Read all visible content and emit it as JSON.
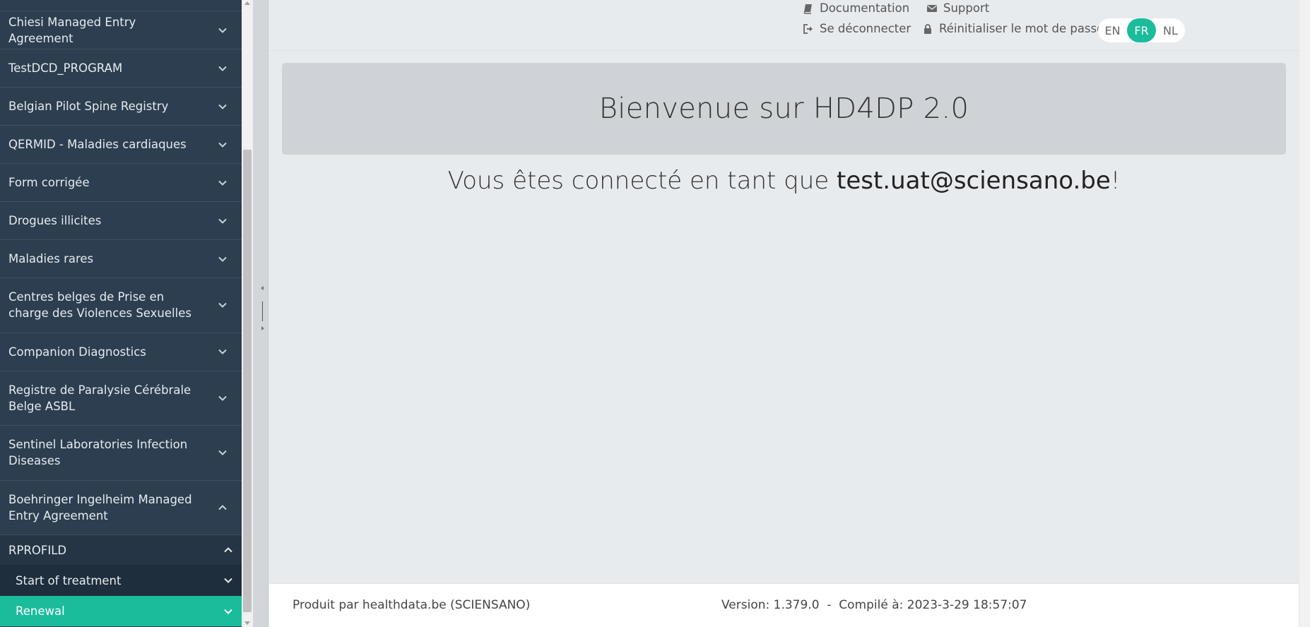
{
  "sidebar": {
    "items": [
      {
        "label": "Chiesi Managed Entry Agreement"
      },
      {
        "label": "TestDCD_PROGRAM"
      },
      {
        "label": "Belgian Pilot Spine Registry"
      },
      {
        "label": "QERMID - Maladies cardiaques"
      },
      {
        "label": "Form corrigée"
      },
      {
        "label": "Drogues illicites"
      },
      {
        "label": "Maladies rares"
      },
      {
        "label": "Centres belges de Prise en charge des Violences Sexuelles"
      },
      {
        "label": "Companion Diagnostics"
      },
      {
        "label": "Registre de Paralysie Cérébrale Belge ASBL"
      },
      {
        "label": "Sentinel Laboratories Infection Diseases"
      },
      {
        "label": "Boehringer Ingelheim Managed Entry Agreement"
      }
    ],
    "sub": {
      "rprofild": "RPROFILD",
      "start_of_treatment": "Start of treatment",
      "renewal": "Renewal"
    }
  },
  "header": {
    "documentation": "Documentation",
    "support": "Support",
    "logout": "Se déconnecter",
    "reset_password": "Réinitialiser le mot de passe",
    "languages": [
      "EN",
      "FR",
      "NL"
    ],
    "active_language": "FR"
  },
  "main": {
    "welcome_title": "Bienvenue sur HD4DP 2.0",
    "connected_prefix": "Vous êtes connecté en tant que ",
    "user_email": "test.uat@sciensano.be",
    "connected_suffix": "!"
  },
  "footer": {
    "produced_by": "Produit par healthdata.be (SCIENSANO)",
    "version": "Version: 1.379.0  -  Compilé à: 2023-3-29 18:57:07"
  },
  "colors": {
    "sidebar_bg": "#2c3e50",
    "accent": "#1abc9c",
    "main_bg": "#e8ebee"
  }
}
